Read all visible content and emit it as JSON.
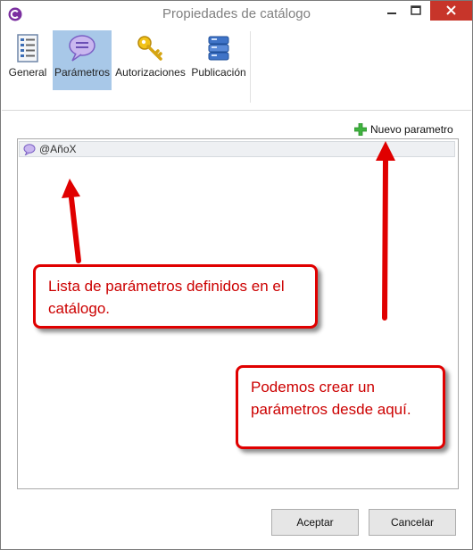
{
  "window": {
    "title": "Propiedades de catálogo"
  },
  "ribbon": {
    "tools": [
      {
        "label": "General",
        "icon": "document-list-icon",
        "active": false
      },
      {
        "label": "Parámetros",
        "icon": "speech-bubble-icon",
        "active": true
      },
      {
        "label": "Autorizaciones",
        "icon": "key-icon",
        "active": false
      },
      {
        "label": "Publicación",
        "icon": "database-stack-icon",
        "active": false
      }
    ]
  },
  "toolbar": {
    "new_param_label": "Nuevo parametro",
    "new_param_icon": "green-plus-icon"
  },
  "param_list": {
    "items": [
      {
        "name": "@AñoX",
        "icon": "speech-bubble-icon"
      }
    ]
  },
  "annotations": {
    "list_note": "Lista de parámetros definidos en el catálogo.",
    "create_note": "Podemos crear un parámetros desde aquí."
  },
  "buttons": {
    "ok": "Aceptar",
    "cancel": "Cancelar"
  },
  "colors": {
    "annotation_red": "#e00000",
    "close_button": "#c7352a",
    "active_tab": "#a8c8e8",
    "accent_purple": "#7b2fa0"
  }
}
